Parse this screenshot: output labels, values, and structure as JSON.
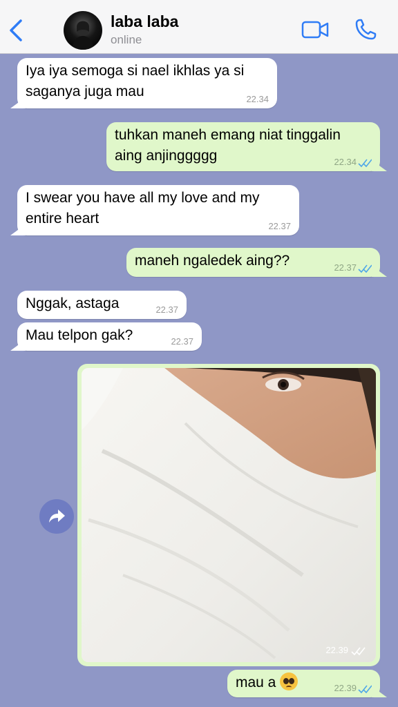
{
  "header": {
    "contact_name": "laba laba",
    "status": "online"
  },
  "messages": [
    {
      "direction": "in",
      "text": "Iya iya semoga si nael ikhlas ya si saganya juga mau",
      "time": "22.34"
    },
    {
      "direction": "out",
      "text": "tuhkan maneh emang niat tinggalin aing anjinggggg",
      "time": "22.34",
      "read": true
    },
    {
      "direction": "in",
      "text": "I swear you have all my love and my entire heart",
      "time": "22.37"
    },
    {
      "direction": "out",
      "text": "maneh ngaledek aing??",
      "time": "22.37",
      "read": true
    },
    {
      "direction": "in",
      "text": "Nggak, astaga",
      "time": "22.37"
    },
    {
      "direction": "in",
      "text": "Mau telpon gak?",
      "time": "22.37"
    },
    {
      "direction": "out",
      "type": "photo",
      "time": "22.39",
      "read": true
    },
    {
      "direction": "out",
      "text": "mau a",
      "emoji": "pleading-face",
      "time": "22.39",
      "read": true
    }
  ],
  "icons": {
    "back": "chevron-left-icon",
    "video": "video-camera-icon",
    "call": "phone-icon",
    "forward": "forward-arrow-icon",
    "read_receipt": "double-check-icon"
  },
  "colors": {
    "chat_background": "#8f97c6",
    "incoming_bubble": "#ffffff",
    "outgoing_bubble": "#e0f7ca",
    "accent": "#2f7cf6",
    "read_tick": "#4fa7e8"
  }
}
